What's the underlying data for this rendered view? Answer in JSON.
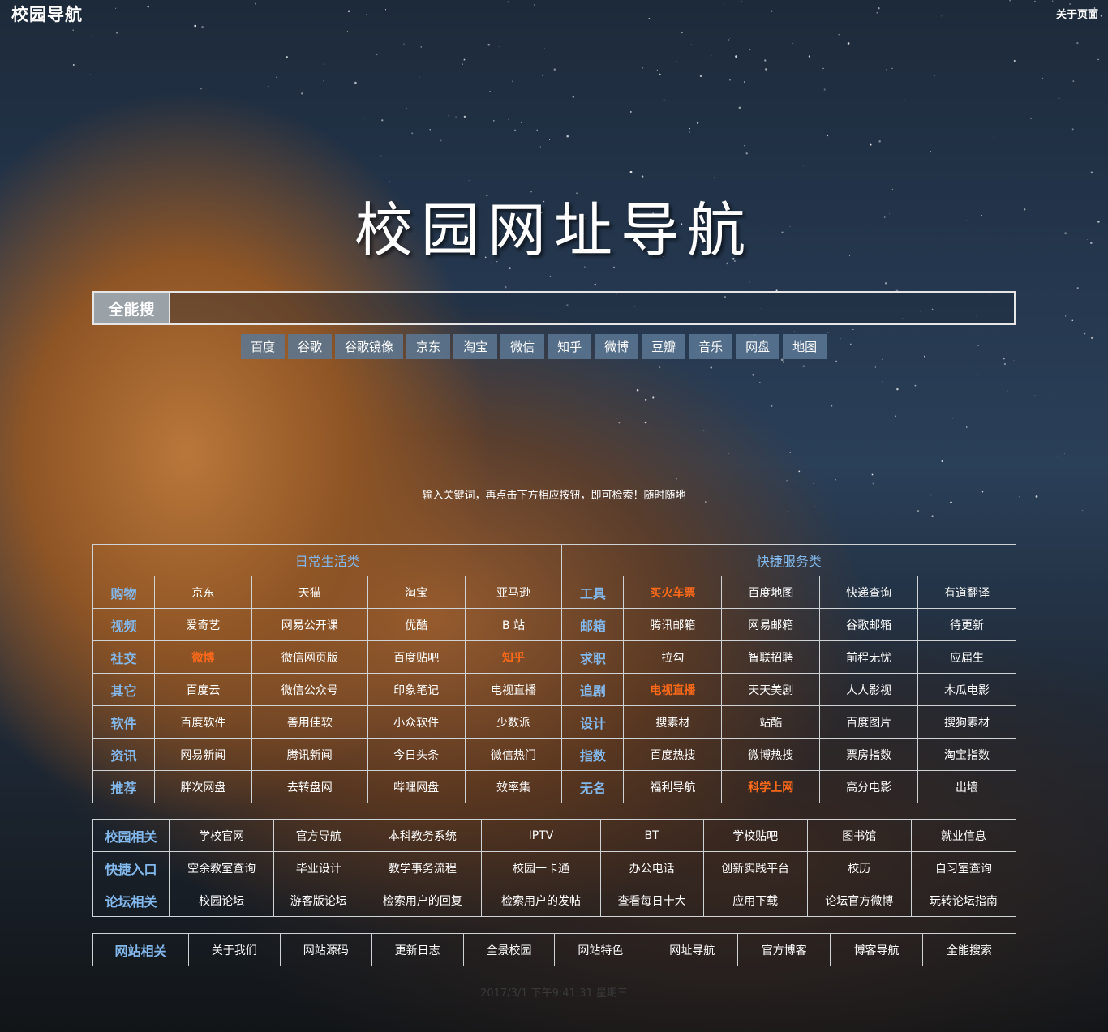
{
  "header": {
    "logo": "校园导航",
    "about_link": "关于页面"
  },
  "hero": {
    "title": "校园网址导航"
  },
  "search": {
    "label": "全能搜",
    "value": "",
    "placeholder": ""
  },
  "engines": [
    "百度",
    "谷歌",
    "谷歌镜像",
    "京东",
    "淘宝",
    "微信",
    "知乎",
    "微博",
    "豆瓣",
    "音乐",
    "网盘",
    "地图"
  ],
  "tip": "输入关键词，再点击下方相应按钮，即可检索！随时随地",
  "daily": {
    "title": "日常生活类",
    "rows": [
      {
        "cat": "购物",
        "items": [
          "京东",
          "天猫",
          "淘宝",
          "亚马逊"
        ]
      },
      {
        "cat": "视频",
        "items": [
          "爱奇艺",
          "网易公开课",
          "优酷",
          "B 站"
        ]
      },
      {
        "cat": "社交",
        "items": [
          "微博",
          "微信网页版",
          "百度贴吧",
          "知乎"
        ]
      },
      {
        "cat": "其它",
        "items": [
          "百度云",
          "微信公众号",
          "印象笔记",
          "电视直播"
        ]
      },
      {
        "cat": "软件",
        "items": [
          "百度软件",
          "善用佳软",
          "小众软件",
          "少数派"
        ]
      },
      {
        "cat": "资讯",
        "items": [
          "网易新闻",
          "腾讯新闻",
          "今日头条",
          "微信热门"
        ]
      },
      {
        "cat": "推荐",
        "items": [
          "胖次网盘",
          "去转盘网",
          "哔哩网盘",
          "效率集"
        ]
      }
    ]
  },
  "service": {
    "title": "快捷服务类",
    "rows": [
      {
        "cat": "工具",
        "items": [
          "买火车票",
          "百度地图",
          "快递查询",
          "有道翻译"
        ]
      },
      {
        "cat": "邮箱",
        "items": [
          "腾讯邮箱",
          "网易邮箱",
          "谷歌邮箱",
          "待更新"
        ]
      },
      {
        "cat": "求职",
        "items": [
          "拉勾",
          "智联招聘",
          "前程无忧",
          "应届生"
        ]
      },
      {
        "cat": "追剧",
        "items": [
          "电视直播",
          "天天美剧",
          "人人影视",
          "木瓜电影"
        ]
      },
      {
        "cat": "设计",
        "items": [
          "搜素材",
          "站酷",
          "百度图片",
          "搜狗素材"
        ]
      },
      {
        "cat": "指数",
        "items": [
          "百度热搜",
          "微博热搜",
          "票房指数",
          "淘宝指数"
        ]
      },
      {
        "cat": "无名",
        "items": [
          "福利导航",
          "科学上网",
          "高分电影",
          "出墙"
        ]
      }
    ]
  },
  "campus": [
    {
      "cat": "校园相关",
      "items": [
        "学校官网",
        "官方导航",
        "本科教务系统",
        "IPTV",
        "BT",
        "学校贴吧",
        "图书馆",
        "就业信息"
      ]
    },
    {
      "cat": "快捷入口",
      "items": [
        "空余教室查询",
        "毕业设计",
        "教学事务流程",
        "校园一卡通",
        "办公电话",
        "创新实践平台",
        "校历",
        "自习室查询"
      ]
    },
    {
      "cat": "论坛相关",
      "items": [
        "校园论坛",
        "游客版论坛",
        "检索用户的回复",
        "检索用户的发帖",
        "查看每日十大",
        "应用下载",
        "论坛官方微博",
        "玩转论坛指南"
      ]
    }
  ],
  "site": {
    "cat": "网站相关",
    "items": [
      "关于我们",
      "网站源码",
      "更新日志",
      "全景校园",
      "网站特色",
      "网址导航",
      "官方博客",
      "博客导航",
      "全能搜索"
    ]
  },
  "footer": "2017/3/1 下午9:41:31 星期三",
  "colors": {
    "category": "#82b8ec",
    "hot": "#ff6a1a",
    "engine_bg": "#5c7894"
  }
}
